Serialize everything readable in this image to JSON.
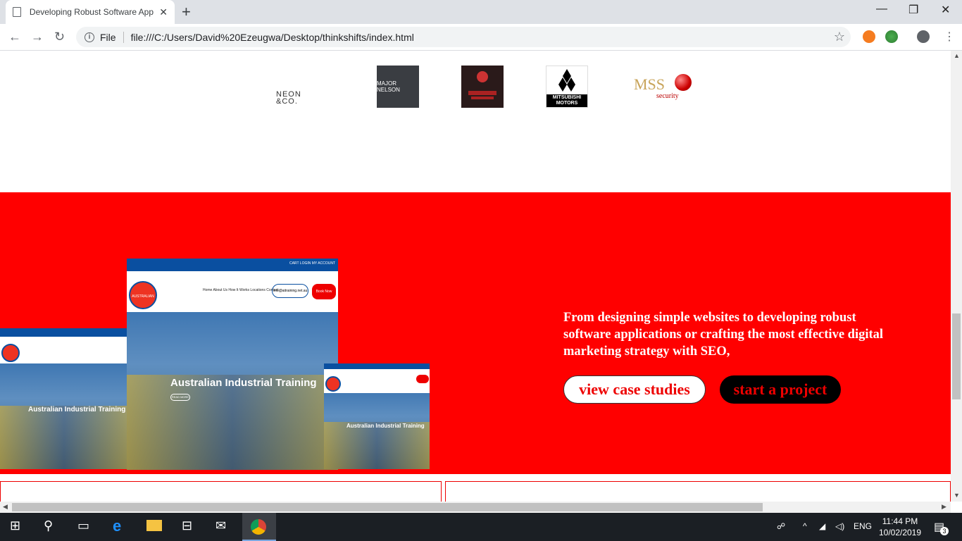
{
  "browser": {
    "tab_title": "Developing Robust Software App",
    "new_tab": "+",
    "close_tab": "✕",
    "security_label": "File",
    "url": "file:///C:/Users/David%20Ezeugwa/Desktop/thinkshifts/index.html",
    "window_controls": {
      "minimize": "—",
      "maximize": "❐",
      "close": "✕"
    }
  },
  "logos": [
    {
      "name": "NEON &CO."
    },
    {
      "name": "MAJOR NELSON"
    },
    {
      "name": "wizard-logo"
    },
    {
      "name": "MITSUBISHI MOTORS"
    },
    {
      "name": "MSS security"
    }
  ],
  "logo_text": {
    "neon_line1": "NEON",
    "neon_line2": "&CO.",
    "major": "MAJOR NELSON",
    "mitsubishi_line1": "MITSUBISHI",
    "mitsubishi_line2": "MOTORS",
    "mss": "MSS",
    "mss_sub": "security"
  },
  "hero": {
    "text": "From designing simple websites to developing robust software applications or crafting the most effective digital marketing strategy with SEO,",
    "btn_case_studies": "view case studies",
    "btn_start_project": "start a project",
    "screenshot_heading": "Australian Industrial Training",
    "screenshot_badge": "AUSTRALIAN",
    "screenshot_nav": "Home  About Us  How It Works  Locations  Contact",
    "screenshot_email": "info@aitraining.net.au",
    "screenshot_book": "Book Now",
    "screenshot_topbar": "CART  LOGIN  MY ACCOUNT",
    "screenshot_read_more": "READ MORE"
  },
  "taskbar": {
    "time": "11:44 PM",
    "date": "10/02/2019",
    "lang": "ENG",
    "notifications": "3"
  },
  "colors": {
    "hero_bg": "#ff0000",
    "button_text": "#ee0000"
  }
}
